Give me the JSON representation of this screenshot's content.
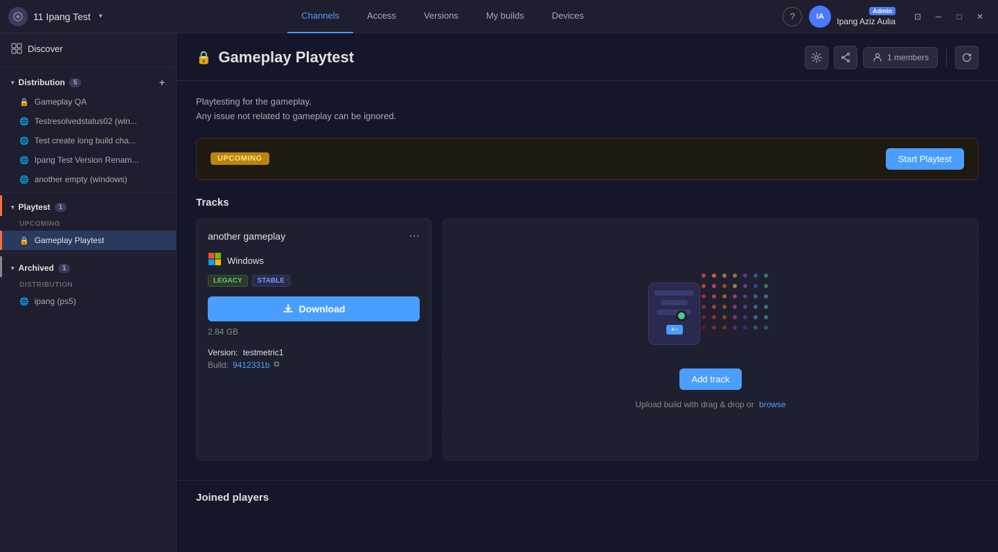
{
  "titlebar": {
    "app_name": "11 Ipang Test",
    "nav_tabs": [
      {
        "label": "Channels",
        "active": true
      },
      {
        "label": "Access",
        "active": false
      },
      {
        "label": "Versions",
        "active": false
      },
      {
        "label": "My builds",
        "active": false
      },
      {
        "label": "Devices",
        "active": false
      }
    ],
    "admin_badge": "Admin",
    "user_name": "Ipang Aziz Aulia",
    "user_initials": "IA"
  },
  "sidebar": {
    "discover_label": "Discover",
    "distribution": {
      "label": "Distribution",
      "count": "5",
      "add_icon": "+",
      "items": [
        {
          "label": "Gameplay QA",
          "icon": "🔒",
          "active": false
        },
        {
          "label": "Testresolvedstatus02 (win...",
          "icon": "🌐",
          "active": false
        },
        {
          "label": "Test create long build cha...",
          "icon": "🌐",
          "active": false
        },
        {
          "label": "Ipang Test Version Renam...",
          "icon": "🌐",
          "active": false
        },
        {
          "label": "another empty (windows)",
          "icon": "🌐",
          "active": false
        }
      ]
    },
    "playtest": {
      "label": "Playtest",
      "count": "1",
      "upcoming_label": "UPCOMING",
      "items": [
        {
          "label": "Gameplay Playtest",
          "icon": "🔒",
          "active": true
        }
      ]
    },
    "archived": {
      "label": "Archived",
      "count": "1",
      "distribution_label": "DISTRIBUTION",
      "items": [
        {
          "label": "ipang (ps5)",
          "icon": "🌐",
          "active": false
        }
      ]
    }
  },
  "content": {
    "page_title": "Gameplay Playtest",
    "lock_icon": "🔒",
    "members_count": "1 members",
    "description_line1": "Playtesting for the gameplay.",
    "description_line2": "Any issue not related to gameplay can be ignored.",
    "status_badge": "UPCOMING",
    "start_playtest_btn": "Start Playtest",
    "tracks_label": "Tracks",
    "track": {
      "name": "another gameplay",
      "platform": "Windows",
      "badge_legacy": "LEGACY",
      "badge_stable": "STABLE",
      "download_btn": "Download",
      "file_size": "2.84 GB",
      "version_label": "Version:",
      "version_value": "testmetric1",
      "build_label": "Build:",
      "build_value": "9412331b"
    },
    "add_track_btn": "Add track",
    "add_track_text": "Upload build with drag & drop or",
    "add_track_browse": "browse",
    "joined_players_label": "Joined players"
  }
}
